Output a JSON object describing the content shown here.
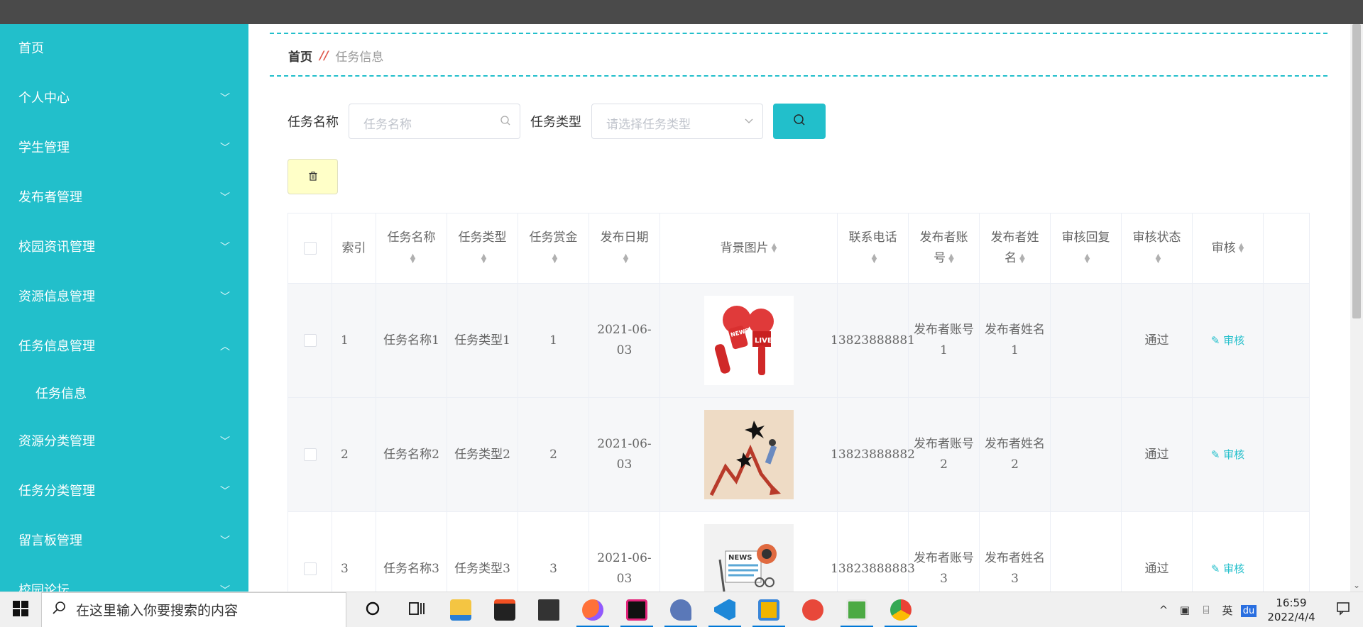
{
  "sidebar": {
    "items": [
      {
        "label": "首页",
        "chevron": ""
      },
      {
        "label": "个人中心",
        "chevron": "﹀"
      },
      {
        "label": "学生管理",
        "chevron": "﹀"
      },
      {
        "label": "发布者管理",
        "chevron": "﹀"
      },
      {
        "label": "校园资讯管理",
        "chevron": "﹀"
      },
      {
        "label": "资源信息管理",
        "chevron": "﹀"
      },
      {
        "label": "任务信息管理",
        "chevron": "︿"
      },
      {
        "label": "资源分类管理",
        "chevron": "﹀"
      },
      {
        "label": "任务分类管理",
        "chevron": "﹀"
      },
      {
        "label": "留言板管理",
        "chevron": "﹀"
      },
      {
        "label": "校园论坛",
        "chevron": "﹀"
      }
    ],
    "sub_item": "任务信息"
  },
  "breadcrumb": {
    "home": "首页",
    "sep": "//",
    "current": "任务信息"
  },
  "search": {
    "name_label": "任务名称",
    "name_placeholder": "任务名称",
    "type_label": "任务类型",
    "type_placeholder": "请选择任务类型"
  },
  "table": {
    "headers": {
      "index": "索引",
      "name": "任务名称",
      "type": "任务类型",
      "reward": "任务赏金",
      "date": "发布日期",
      "image": "背景图片",
      "phone": "联系电话",
      "account": "发布者账号",
      "publisher": "发布者姓名",
      "reply": "审核回复",
      "status": "审核状态",
      "audit": "审核"
    },
    "rows": [
      {
        "index": "1",
        "name": "任务名称1",
        "type": "任务类型1",
        "reward": "1",
        "date": "2021-06-03",
        "phone": "13823888881",
        "account": "发布者账号1",
        "publisher": "发布者姓名1",
        "reply": "",
        "status": "通过",
        "audit": "审核",
        "image_icon": "news-microphone-icon"
      },
      {
        "index": "2",
        "name": "任务名称2",
        "type": "任务类型2",
        "reward": "2",
        "date": "2021-06-03",
        "phone": "13823888882",
        "account": "发布者账号2",
        "publisher": "发布者姓名2",
        "reply": "",
        "status": "通过",
        "audit": "审核",
        "image_icon": "falling-chart-icon"
      },
      {
        "index": "3",
        "name": "任务名称3",
        "type": "任务类型3",
        "reward": "3",
        "date": "2021-06-03",
        "phone": "13823888883",
        "account": "发布者账号3",
        "publisher": "发布者姓名3",
        "reply": "",
        "status": "通过",
        "audit": "审核",
        "image_icon": "newspaper-icon"
      }
    ]
  },
  "taskbar": {
    "search_placeholder": "在这里输入你要搜索的内容",
    "time": "16:59",
    "date": "2022/4/4",
    "ime": "英",
    "baidu": "du"
  },
  "colors": {
    "accent": "#22bfcb",
    "delete_btn": "#ffffc8",
    "topbar": "#4a4a4a"
  }
}
